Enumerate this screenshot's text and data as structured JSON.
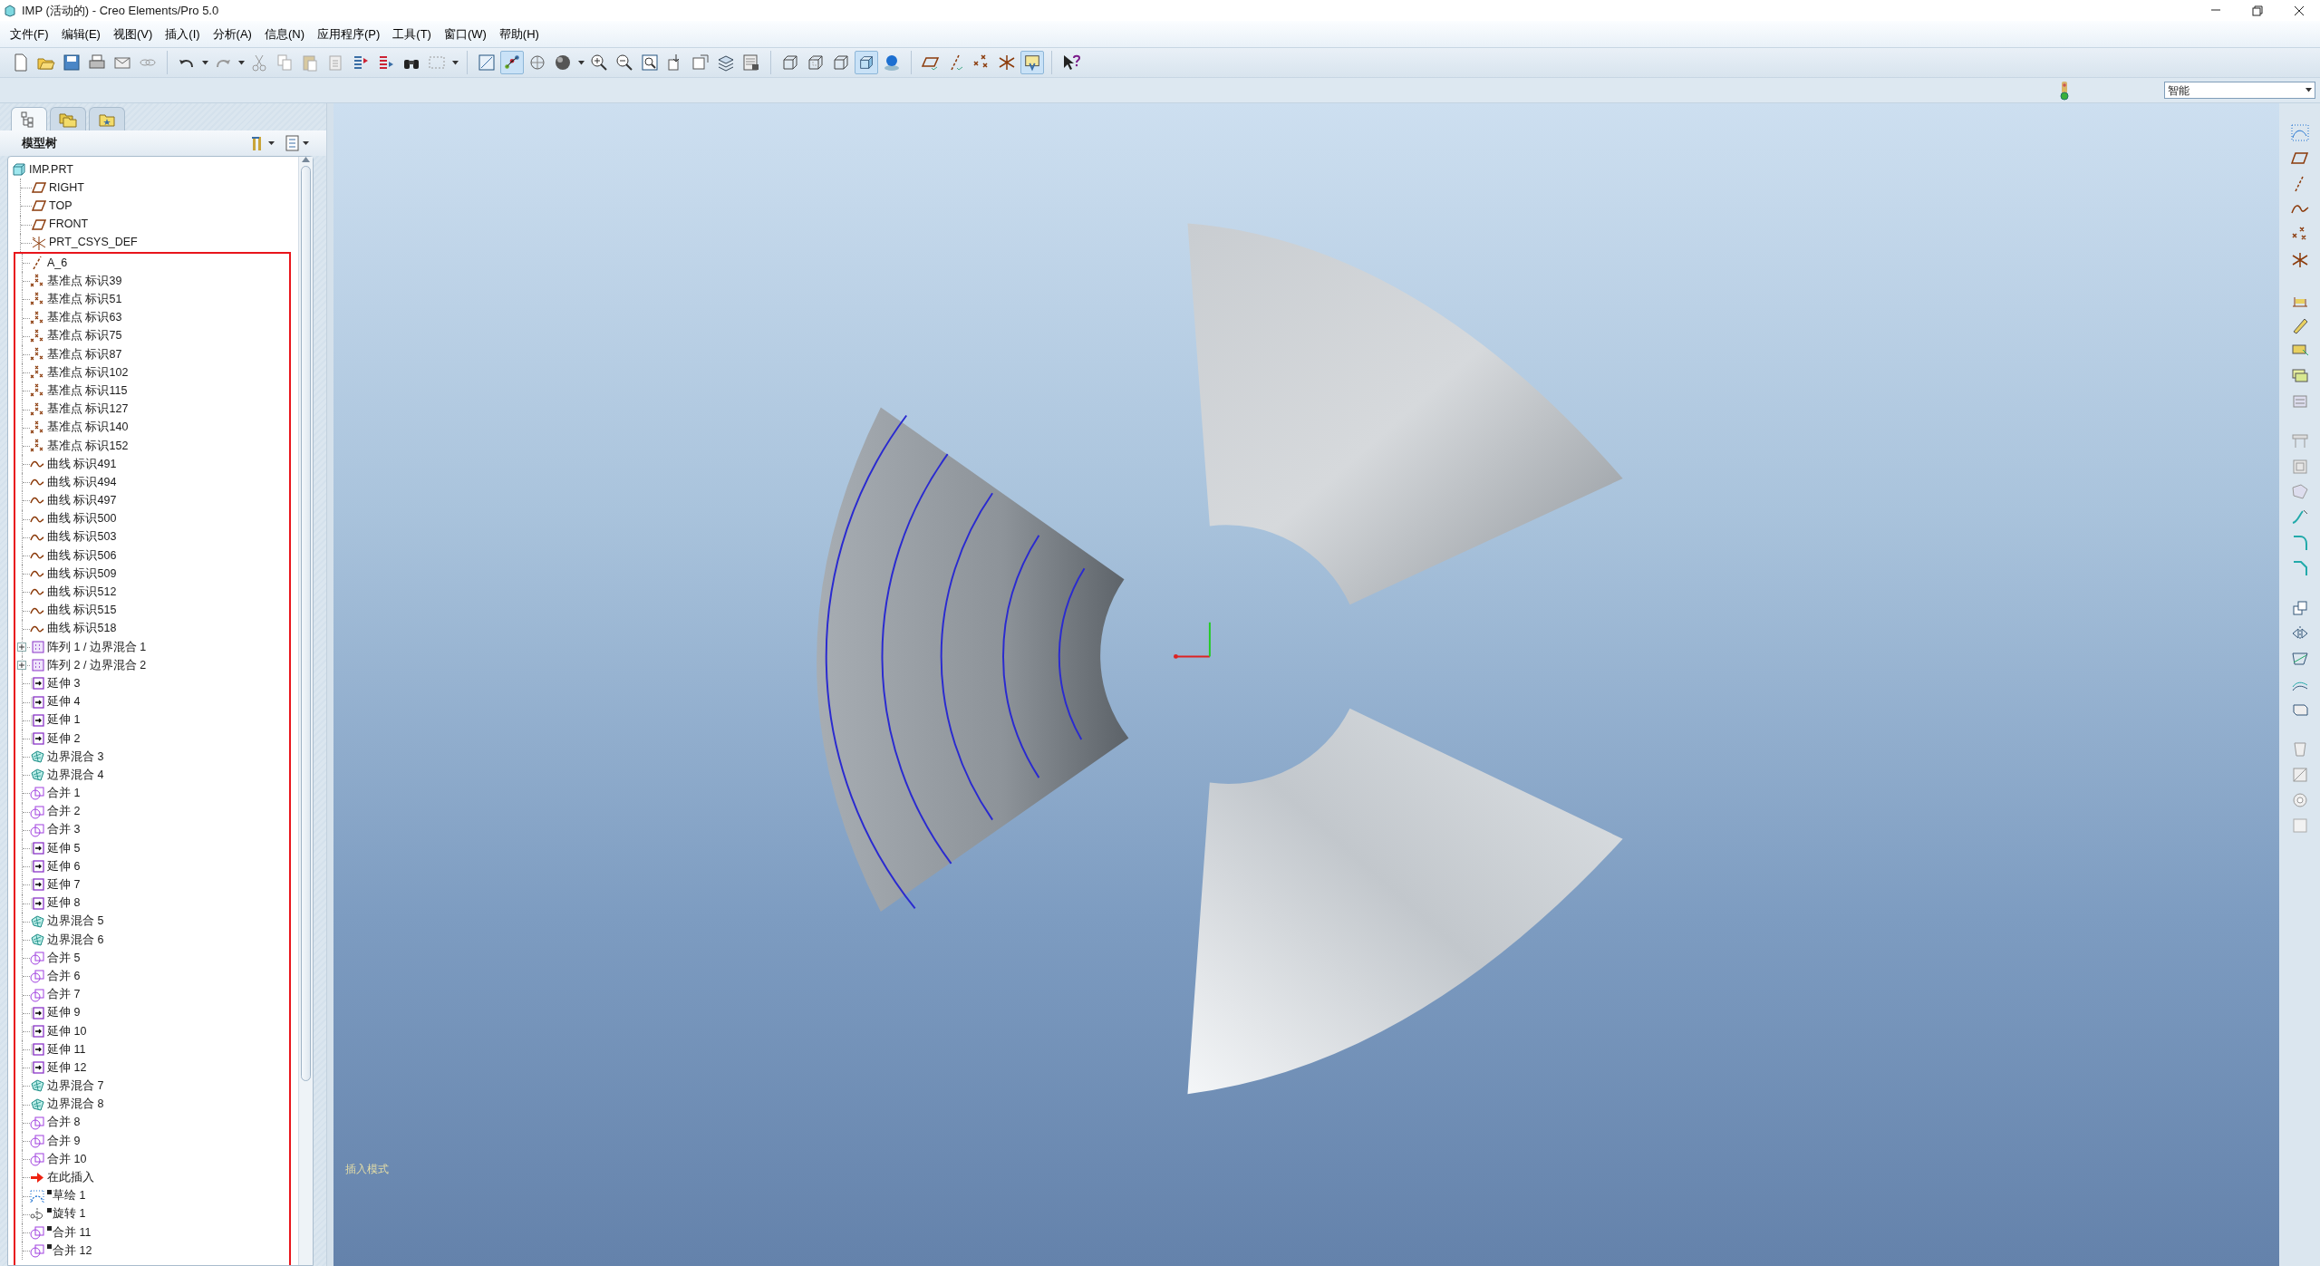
{
  "window": {
    "title": "IMP (活动的) - Creo Elements/Pro 5.0"
  },
  "menu": [
    "文件(F)",
    "编辑(E)",
    "视图(V)",
    "插入(I)",
    "分析(A)",
    "信息(N)",
    "应用程序(P)",
    "工具(T)",
    "窗口(W)",
    "帮助(H)"
  ],
  "selection_filter": {
    "value": "智能"
  },
  "panel_tabs": [
    {
      "kind": "tree",
      "selected": true
    },
    {
      "kind": "folders",
      "selected": false
    },
    {
      "kind": "favorites",
      "selected": false
    }
  ],
  "model_tree": {
    "title": "模型树",
    "root": {
      "label": "IMP.PRT",
      "kind": "part",
      "children": [
        {
          "label": "RIGHT",
          "kind": "plane",
          "framed": false,
          "flagged": false
        },
        {
          "label": "TOP",
          "kind": "plane",
          "framed": false,
          "flagged": false
        },
        {
          "label": "FRONT",
          "kind": "plane",
          "framed": false,
          "flagged": false
        },
        {
          "label": "PRT_CSYS_DEF",
          "kind": "csys",
          "framed": false,
          "flagged": false
        },
        {
          "label": "A_6",
          "kind": "axis",
          "framed": true,
          "flagged": false
        },
        {
          "label": "基准点 标识39",
          "kind": "point",
          "framed": true,
          "flagged": false
        },
        {
          "label": "基准点 标识51",
          "kind": "point",
          "framed": true,
          "flagged": false
        },
        {
          "label": "基准点 标识63",
          "kind": "point",
          "framed": true,
          "flagged": false
        },
        {
          "label": "基准点 标识75",
          "kind": "point",
          "framed": true,
          "flagged": false
        },
        {
          "label": "基准点 标识87",
          "kind": "point",
          "framed": true,
          "flagged": false
        },
        {
          "label": "基准点 标识102",
          "kind": "point",
          "framed": true,
          "flagged": false
        },
        {
          "label": "基准点 标识115",
          "kind": "point",
          "framed": true,
          "flagged": false
        },
        {
          "label": "基准点 标识127",
          "kind": "point",
          "framed": true,
          "flagged": false
        },
        {
          "label": "基准点 标识140",
          "kind": "point",
          "framed": true,
          "flagged": false
        },
        {
          "label": "基准点 标识152",
          "kind": "point",
          "framed": true,
          "flagged": false
        },
        {
          "label": "曲线 标识491",
          "kind": "curve",
          "framed": true,
          "flagged": false
        },
        {
          "label": "曲线 标识494",
          "kind": "curve",
          "framed": true,
          "flagged": false
        },
        {
          "label": "曲线 标识497",
          "kind": "curve",
          "framed": true,
          "flagged": false
        },
        {
          "label": "曲线 标识500",
          "kind": "curve",
          "framed": true,
          "flagged": false
        },
        {
          "label": "曲线 标识503",
          "kind": "curve",
          "framed": true,
          "flagged": false
        },
        {
          "label": "曲线 标识506",
          "kind": "curve",
          "framed": true,
          "flagged": false
        },
        {
          "label": "曲线 标识509",
          "kind": "curve",
          "framed": true,
          "flagged": false
        },
        {
          "label": "曲线 标识512",
          "kind": "curve",
          "framed": true,
          "flagged": false
        },
        {
          "label": "曲线 标识515",
          "kind": "curve",
          "framed": true,
          "flagged": false
        },
        {
          "label": "曲线 标识518",
          "kind": "curve",
          "framed": true,
          "flagged": false
        },
        {
          "label": "阵列 1 / 边界混合 1",
          "kind": "pattern",
          "framed": true,
          "flagged": false,
          "expanded": false
        },
        {
          "label": "阵列 2 / 边界混合 2",
          "kind": "pattern",
          "framed": true,
          "flagged": false,
          "expanded": false
        },
        {
          "label": "延伸 3",
          "kind": "extend",
          "framed": true,
          "flagged": false
        },
        {
          "label": "延伸 4",
          "kind": "extend",
          "framed": true,
          "flagged": false
        },
        {
          "label": "延伸 1",
          "kind": "extend",
          "framed": true,
          "flagged": false
        },
        {
          "label": "延伸 2",
          "kind": "extend",
          "framed": true,
          "flagged": false
        },
        {
          "label": "边界混合 3",
          "kind": "blend",
          "framed": true,
          "flagged": false
        },
        {
          "label": "边界混合 4",
          "kind": "blend",
          "framed": true,
          "flagged": false
        },
        {
          "label": "合并 1",
          "kind": "merge",
          "framed": true,
          "flagged": false
        },
        {
          "label": "合并 2",
          "kind": "merge",
          "framed": true,
          "flagged": false
        },
        {
          "label": "合并 3",
          "kind": "merge",
          "framed": true,
          "flagged": false
        },
        {
          "label": "延伸 5",
          "kind": "extend",
          "framed": true,
          "flagged": false
        },
        {
          "label": "延伸 6",
          "kind": "extend",
          "framed": true,
          "flagged": false
        },
        {
          "label": "延伸 7",
          "kind": "extend",
          "framed": true,
          "flagged": false
        },
        {
          "label": "延伸 8",
          "kind": "extend",
          "framed": true,
          "flagged": false
        },
        {
          "label": "边界混合 5",
          "kind": "blend",
          "framed": true,
          "flagged": false
        },
        {
          "label": "边界混合 6",
          "kind": "blend",
          "framed": true,
          "flagged": false
        },
        {
          "label": "合并 5",
          "kind": "merge",
          "framed": true,
          "flagged": false
        },
        {
          "label": "合并 6",
          "kind": "merge",
          "framed": true,
          "flagged": false
        },
        {
          "label": "合并 7",
          "kind": "merge",
          "framed": true,
          "flagged": false
        },
        {
          "label": "延伸 9",
          "kind": "extend",
          "framed": true,
          "flagged": false
        },
        {
          "label": "延伸 10",
          "kind": "extend",
          "framed": true,
          "flagged": false
        },
        {
          "label": "延伸 11",
          "kind": "extend",
          "framed": true,
          "flagged": false
        },
        {
          "label": "延伸 12",
          "kind": "extend",
          "framed": true,
          "flagged": false
        },
        {
          "label": "边界混合 7",
          "kind": "blend",
          "framed": true,
          "flagged": false
        },
        {
          "label": "边界混合 8",
          "kind": "blend",
          "framed": true,
          "flagged": false
        },
        {
          "label": "合并 8",
          "kind": "merge",
          "framed": true,
          "flagged": false
        },
        {
          "label": "合并 9",
          "kind": "merge",
          "framed": true,
          "flagged": false
        },
        {
          "label": "合并 10",
          "kind": "merge",
          "framed": true,
          "flagged": false
        },
        {
          "label": "在此插入",
          "kind": "insert",
          "framed": true,
          "flagged": false
        },
        {
          "label": "草绘 1",
          "kind": "sketch",
          "framed": true,
          "flagged": true
        },
        {
          "label": "旋转 1",
          "kind": "revolve",
          "framed": true,
          "flagged": true
        },
        {
          "label": "合并 11",
          "kind": "merge",
          "framed": true,
          "flagged": true
        },
        {
          "label": "合并 12",
          "kind": "merge",
          "framed": true,
          "flagged": true
        }
      ]
    }
  },
  "viewport": {
    "status_text": "插入模式"
  }
}
